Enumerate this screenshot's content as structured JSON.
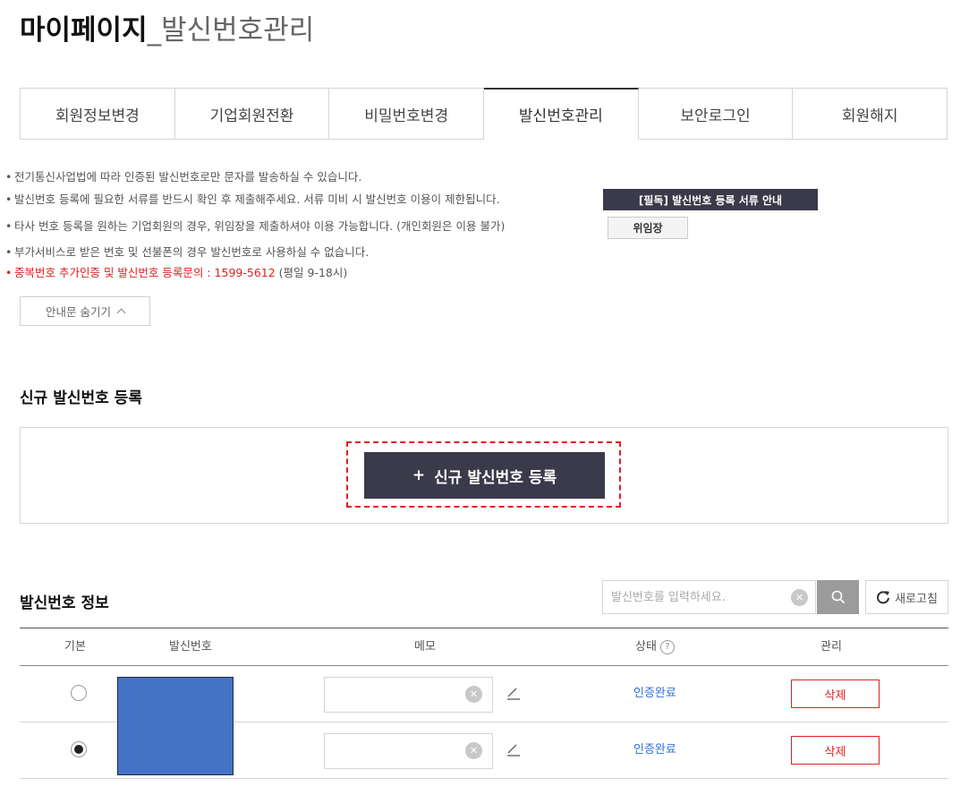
{
  "page": {
    "title_bold": "마이페이지",
    "title_sep": "_",
    "title_light": "발신번호관리"
  },
  "tabs": [
    {
      "label": "회원정보변경",
      "active": false
    },
    {
      "label": "기업회원전환",
      "active": false
    },
    {
      "label": "비밀번호변경",
      "active": false
    },
    {
      "label": "발신번호관리",
      "active": true
    },
    {
      "label": "보안로그인",
      "active": false
    },
    {
      "label": "회원해지",
      "active": false
    }
  ],
  "notices": {
    "bullet": "•",
    "line1": "전기통신사업법에 따라 인증된 발신번호로만 문자를 발송하실 수 있습니다.",
    "line2": "발신번호 등록에 필요한 서류를 반드시 확인 후 제출해주세요. 서류 미비 시 발신번호 이용이 제한됩니다.",
    "line2_button": "[필독] 발신번호 등록 서류 안내",
    "line3": "타사 번호 등록을 원하는 기업회원의 경우, 위임장을 제출하셔야 이용 가능합니다. (개인회원은 이용 불가)",
    "line3_button": "위임장",
    "line4": "부가서비스로 받은 번호 및 선불폰의 경우 발신번호로 사용하실 수 없습니다.",
    "line5_red": "중복번호 추가인증 및 발신번호 등록문의 : 1599-5612",
    "line5_plain": " (평일 9-18시)",
    "hide_label": "안내문 숨기기"
  },
  "register": {
    "section_title": "신규 발신번호 등록",
    "plus": "+",
    "button_label": "신규 발신번호 등록"
  },
  "info": {
    "section_title": "발신번호 정보",
    "search_placeholder": "발신번호를 입력하세요.",
    "refresh_label": "새로고침",
    "columns": {
      "default": "기본",
      "number": "발신번호",
      "memo": "메모",
      "status": "상태",
      "status_help": "?",
      "manage": "관리"
    },
    "rows": [
      {
        "default_selected": false,
        "memo": "",
        "status": "인증완료",
        "delete_label": "삭제"
      },
      {
        "default_selected": true,
        "memo": "",
        "status": "인증완료",
        "delete_label": "삭제"
      }
    ]
  },
  "colors": {
    "dark_button": "#3b3a4a",
    "alert_red": "#e02020",
    "status_blue": "#2f6fd6",
    "redaction_blue": "#4472c4"
  }
}
